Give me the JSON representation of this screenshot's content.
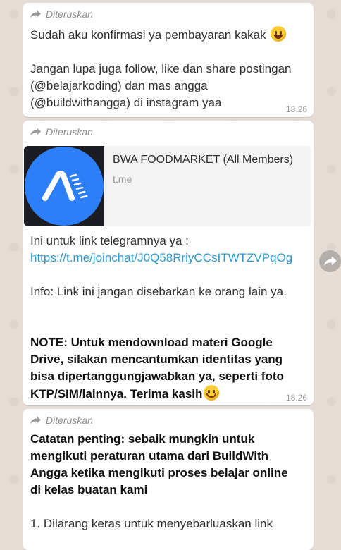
{
  "messages": [
    {
      "forwarded_label": "Diteruskan",
      "lines": [
        "Sudah aku konfirmasi ya pembayaran kakak",
        "",
        "Jangan lupa juga follow, like dan share postingan",
        "(@belajarkoding) dan mas angga",
        "(@buildwithangga) di instagram yaa"
      ],
      "time": "18.26"
    },
    {
      "forwarded_label": "Diteruskan",
      "preview": {
        "title": "BWA FOODMARKET (All Members)",
        "domain": "t.me"
      },
      "intro": "Ini untuk link telegramnya ya :",
      "link": "https://t.me/joinchat/J0Q58RriyCCsITWTZVPqOg",
      "info": "Info: Link ini jangan disebarkan ke orang lain ya.",
      "note_lines": [
        "NOTE: Untuk mendownload materi Google",
        "Drive, silakan mencantumkan identitas yang",
        "bisa dipertanggungjawabkan ya, seperti foto",
        "KTP/SIM/lainnya. Terima kasih"
      ],
      "time": "18.26"
    },
    {
      "forwarded_label": "Diteruskan",
      "heading_lines": [
        "Catatan penting: sebaik mungkin untuk",
        "mengikuti peraturan utama dari BuildWith",
        "Angga ketika mengikuti proses belajar online",
        "di kelas buatan kami"
      ],
      "item_1": "1. Dilarang keras untuk menyebarluaskan link"
    }
  ],
  "icons": [
    "forward-icon",
    "grinning-emoji",
    "smiling-emoji",
    "bwa-logo-icon",
    "forward-button-icon"
  ],
  "colors": {
    "background": "#e5ddd5",
    "bubble": "#ffffff",
    "link": "#2b9bd6",
    "logo_blue": "#2d7ff9"
  }
}
